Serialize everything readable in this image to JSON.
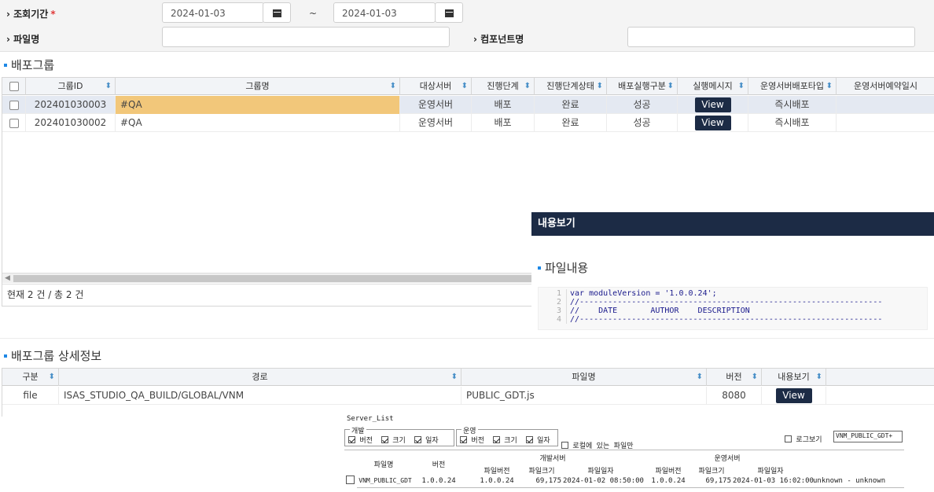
{
  "filter": {
    "period_label": "조회기간",
    "required_mark": "*",
    "date_from": "2024-01-03",
    "date_to": "2024-01-03",
    "tilde": "~",
    "file_label": "파일명",
    "file_value": "",
    "component_label": "컴포넌트명",
    "component_value": "",
    "chevron": "›"
  },
  "group_section": {
    "title": "배포그룹",
    "columns": [
      "",
      "그룹ID",
      "그룹명",
      "대상서버",
      "진행단계",
      "진행단계상태",
      "배포실행구분",
      "실행메시지",
      "운영서버배포타입",
      "운영서버예약일시"
    ],
    "rows": [
      {
        "id": "202401030003",
        "name": "#QA",
        "server": "운영서버",
        "stage": "배포",
        "status": "완료",
        "exec": "성공",
        "message": "View",
        "deploy_type": "즉시배포",
        "reserved": ""
      },
      {
        "id": "202401030002",
        "name": "#QA",
        "server": "운영서버",
        "stage": "배포",
        "status": "완료",
        "exec": "성공",
        "message": "View",
        "deploy_type": "즉시배포",
        "reserved": ""
      }
    ],
    "footer": "현재 2 건 / 총 2 건"
  },
  "popup": {
    "title": "내용보기",
    "section": "파일내용",
    "code_lines": [
      {
        "num": "1",
        "text": "var moduleVersion = '1.0.0.24';"
      },
      {
        "num": "2",
        "text": "//----------------------------------------------------------------"
      },
      {
        "num": "3",
        "text": "//    DATE       AUTHOR    DESCRIPTION"
      },
      {
        "num": "4",
        "text": "//----------------------------------------------------------------"
      }
    ]
  },
  "detail_section": {
    "title": "배포그룹 상세정보",
    "columns": [
      "구분",
      "경로",
      "파일명",
      "버전",
      "내용보기"
    ],
    "rows": [
      {
        "type": "file",
        "path": "ISAS_STUDIO_QA_BUILD/GLOBAL/VNM",
        "file": "PUBLIC_GDT.js",
        "version": "8080",
        "view": "View"
      }
    ]
  },
  "server_list": {
    "title": "Server_List",
    "dev_group": "개발",
    "ops_group": "운영",
    "opt_version": "버전",
    "opt_size": "크기",
    "opt_date": "일자",
    "local_only": "로컬에 있는 파일만",
    "log_view": "로그보기",
    "log_value": "VNM_PUBLIC_GDT+",
    "col_file": "파일명",
    "col_version": "버전",
    "dev_server": "개발서버",
    "ops_server": "운영서버",
    "col_file_version": "파일버전",
    "col_file_size": "파일크기",
    "col_file_date": "파일일자",
    "row": {
      "file": "VNM_PUBLIC_GDT",
      "version": "1.0.0.24",
      "dev_version": "1.0.0.24",
      "dev_size": "69,175",
      "dev_date": "2024-01-02 08:50:00",
      "ops_version": "1.0.0.24",
      "ops_size": "69,175",
      "ops_date": "2024-01-03 16:02:00",
      "author": "unknown - unknown"
    }
  }
}
